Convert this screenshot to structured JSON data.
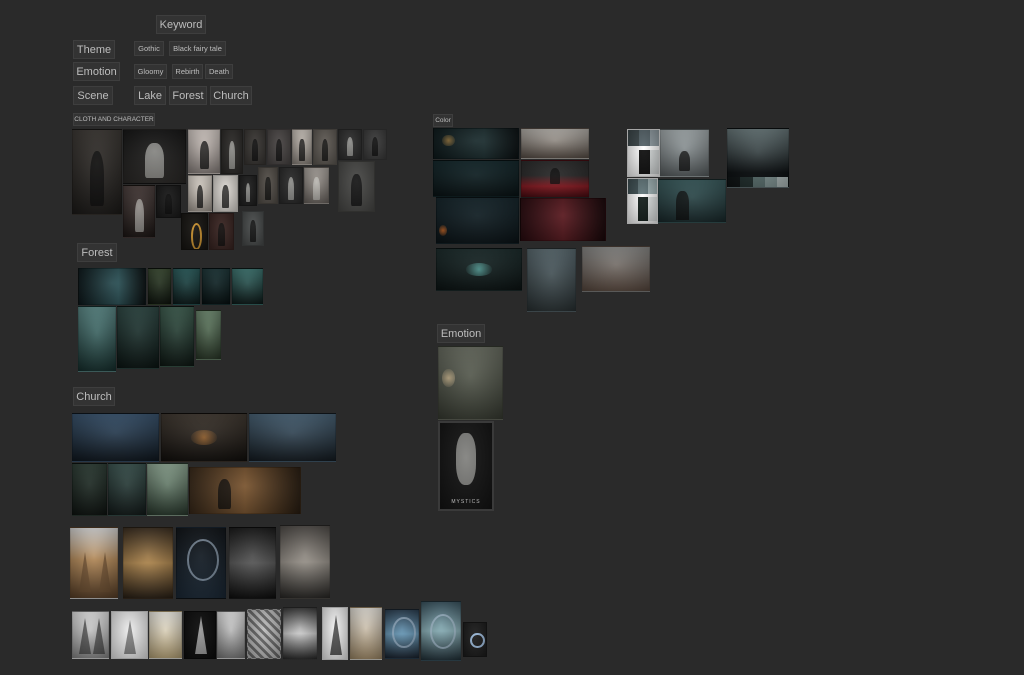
{
  "board": {
    "keyword": "Keyword",
    "rows": {
      "theme": {
        "label": "Theme",
        "tags": [
          "Gothic",
          "Black fairy tale"
        ]
      },
      "emotion": {
        "label": "Emotion",
        "tags": [
          "Gloomy",
          "Rebirth",
          "Death"
        ]
      },
      "scene": {
        "label": "Scene",
        "tags": [
          "Lake",
          "Forest",
          "Church"
        ]
      }
    },
    "sections": {
      "cloth": "CLOTH AND CHARACTER",
      "forest": "Forest",
      "church": "Church",
      "color": "Color",
      "emotion": "Emotion"
    },
    "tarot_caption": "MYSTICS"
  },
  "colors": {
    "background": "#2a2a2a",
    "tag_bg": "#333333",
    "tag_text": "#bdbdbd",
    "accent_red": "#8a1a22",
    "accent_teal": "#4fb6b0"
  },
  "palettes": [
    [
      "#3a4548",
      "#56646a",
      "#8e9aa0",
      "#ffffff",
      "#111111",
      "#d8dcdc"
    ],
    [
      "#3d4e52",
      "#63787c",
      "#9fb2b4",
      "#ffffff",
      "#15201d",
      "#e0e4e4"
    ],
    [
      "#0f1415",
      "#22302f",
      "#5e7473",
      "#849897",
      "#b4c1c0"
    ]
  ]
}
